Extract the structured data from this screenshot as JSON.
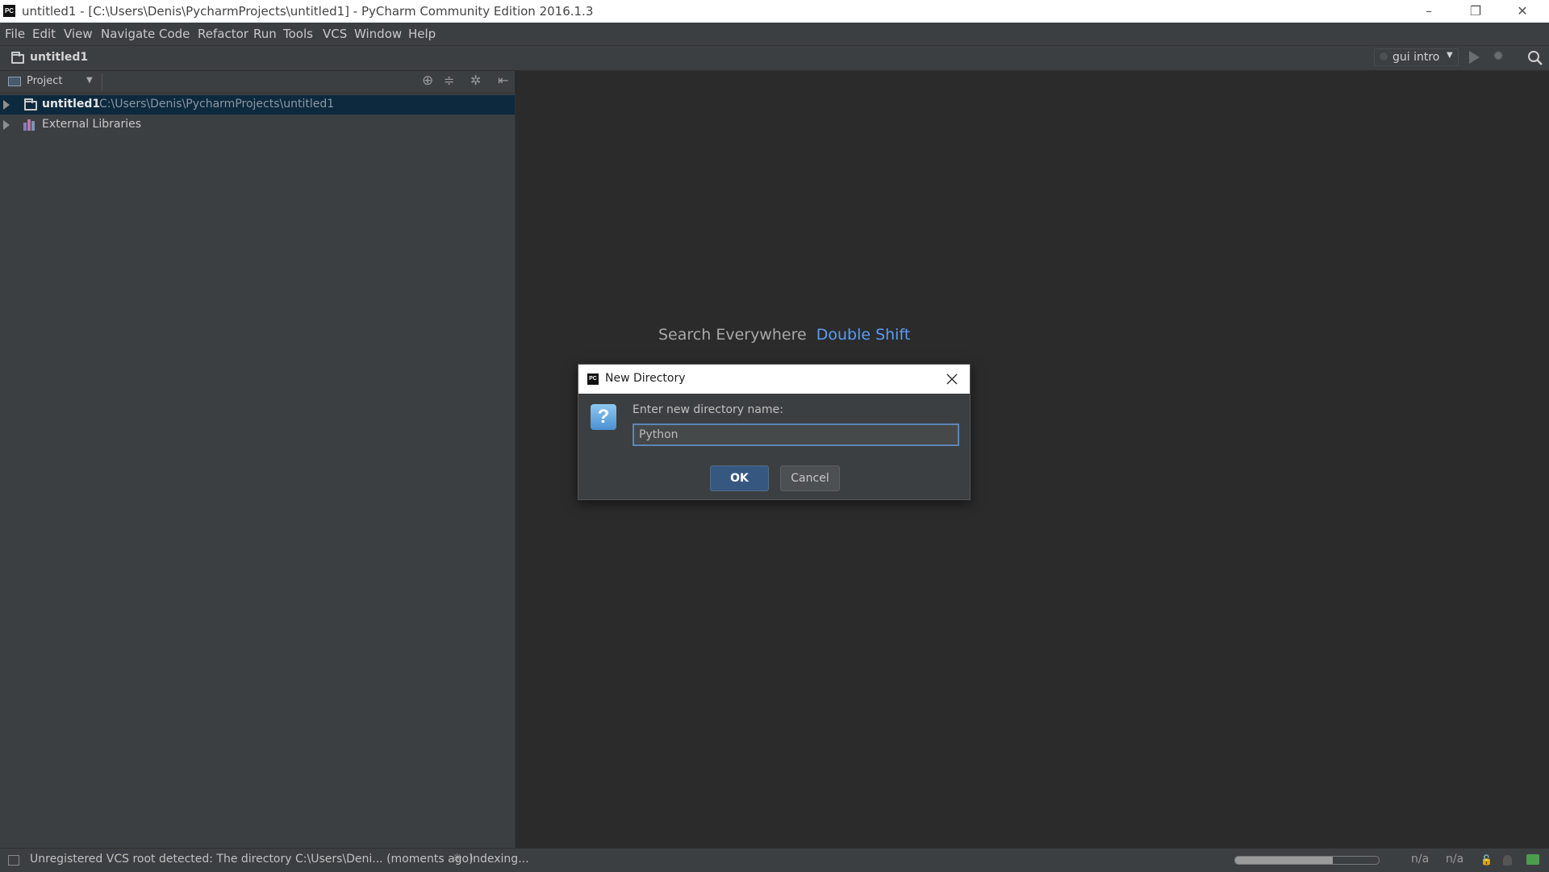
{
  "titlebar": {
    "logo": "PC",
    "title": "untitled1 - [C:\\Users\\Denis\\PycharmProjects\\untitled1] - PyCharm Community Edition 2016.1.3",
    "minimize": "–",
    "restore": "❐",
    "close": "✕"
  },
  "menu": [
    "File",
    "Edit",
    "View",
    "Navigate",
    "Code",
    "Refactor",
    "Run",
    "Tools",
    "VCS",
    "Window",
    "Help"
  ],
  "navbar": {
    "project": "untitled1",
    "run_config": "gui intro"
  },
  "project_panel": {
    "view_label": "Project",
    "tree": [
      {
        "name": "untitled1",
        "path": "C:\\Users\\Denis\\PycharmProjects\\untitled1"
      },
      {
        "name": "External Libraries"
      }
    ]
  },
  "editor": {
    "hint_label": "Search Everywhere",
    "hint_shortcut": "Double Shift"
  },
  "dialog": {
    "logo": "PC",
    "title": "New Directory",
    "prompt": "Enter new directory name:",
    "value": "Python",
    "ok": "OK",
    "cancel": "Cancel"
  },
  "statusbar": {
    "message": "Unregistered VCS root detected: The directory C:\\Users\\Deni... (moments ago)",
    "indexing": "Indexing...",
    "pos1": "n/a",
    "pos2": "n/a"
  },
  "colors": {
    "accent_link": "#589df6",
    "selection": "#0d293e",
    "dialog_bg": "#3c3f41",
    "editor_bg": "#2b2b2b"
  }
}
